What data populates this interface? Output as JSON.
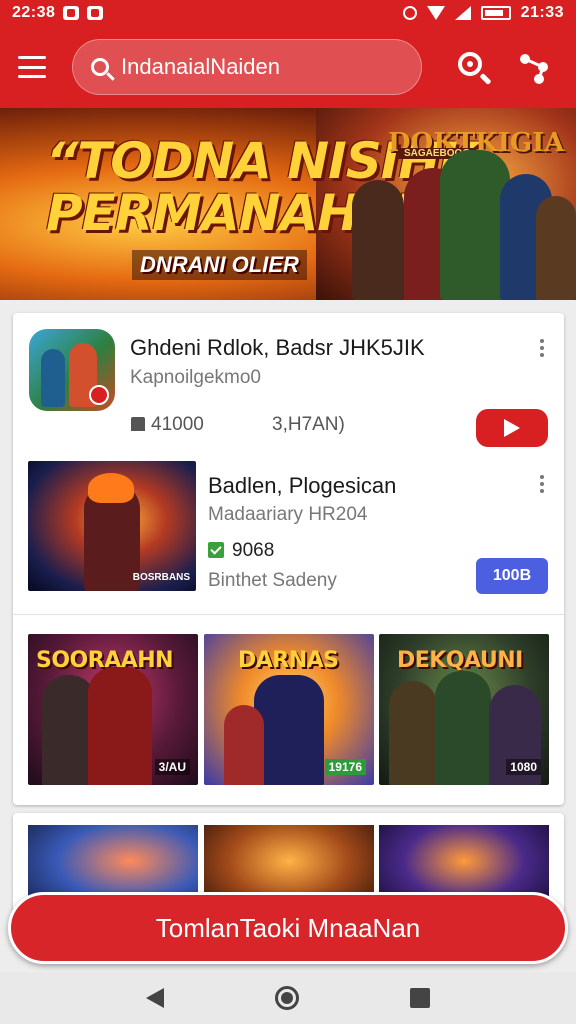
{
  "status": {
    "time_left": "22:38",
    "time_right": "21:33"
  },
  "appbar": {
    "search_text": "IndanaialNaiden",
    "icons": [
      "hamburger-menu-icon",
      "search-icon",
      "share-icon"
    ]
  },
  "banner": {
    "line1": "“TODNA NISIHK",
    "line2": "PERMANAH!”",
    "subtitle": "DNRANI OLIER",
    "logo": "DOKTKIGIA",
    "logo_sub": "SAGAEBOOG"
  },
  "featured": {
    "title": "Ghdeni Rdlok, Badsr JHK5JIK",
    "subtitle": "Kapnoilgekmo0",
    "stat1": "41000",
    "stat2": "3,H7AN)"
  },
  "second": {
    "title": "Badlen, Plogesican",
    "subtitle": "Madaariary HR204",
    "stat": "9068",
    "meta": "Binthet Sadeny",
    "button": "100B",
    "thumb_tag": "BOSRBANS"
  },
  "tiles": [
    {
      "title": "SOORAAHN",
      "price": "3/AU",
      "accent": "#ffd23a"
    },
    {
      "title": "DARNAS",
      "price": "19176",
      "accent": "#ffd23a"
    },
    {
      "title": "DEKQAUNI",
      "price": "1080",
      "accent": "#ffb347"
    }
  ],
  "cta": {
    "label": "TomlanTaoki MnaaNan"
  }
}
